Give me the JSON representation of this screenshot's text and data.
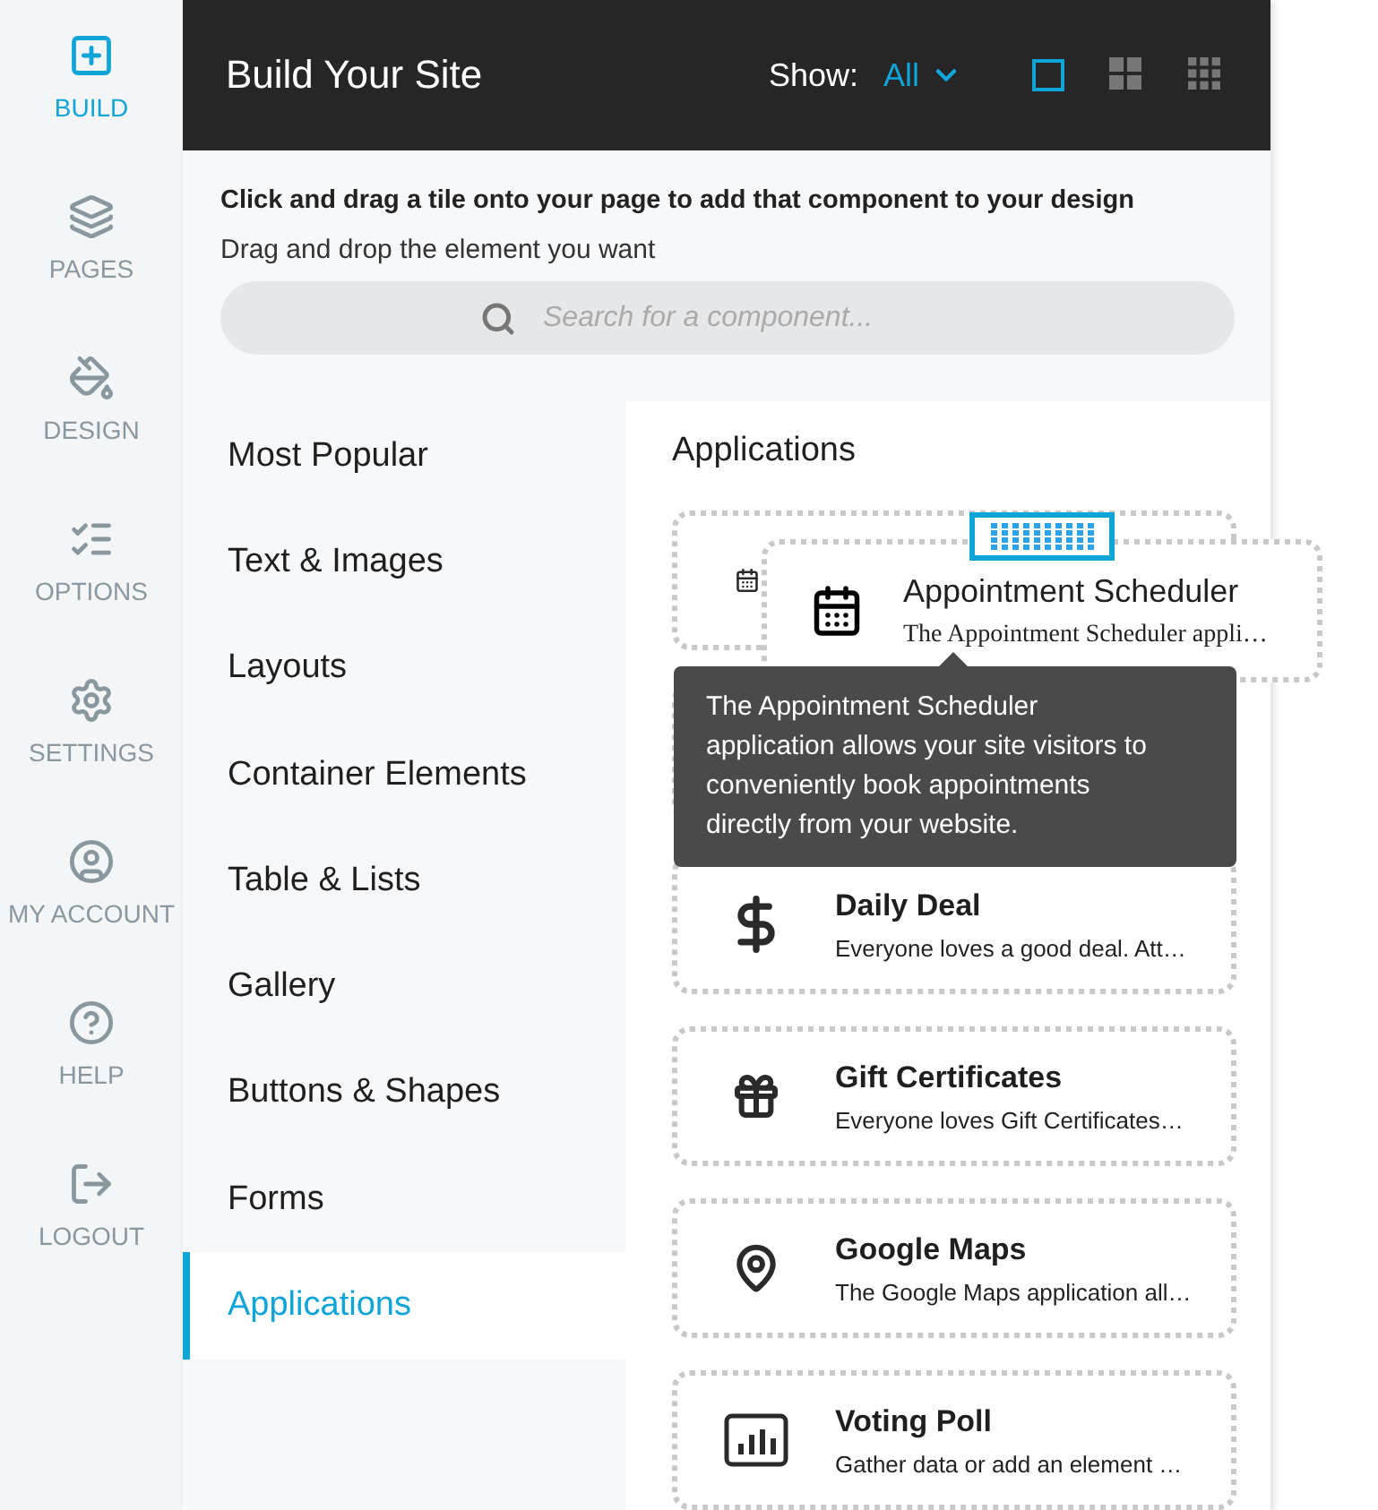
{
  "nav": [
    {
      "label": "BUILD",
      "selected": true
    },
    {
      "label": "PAGES",
      "selected": false
    },
    {
      "label": "DESIGN",
      "selected": false
    },
    {
      "label": "OPTIONS",
      "selected": false
    },
    {
      "label": "SETTINGS",
      "selected": false
    },
    {
      "label": "MY ACCOUNT",
      "selected": false
    },
    {
      "label": "HELP",
      "selected": false
    },
    {
      "label": "LOGOUT",
      "selected": false
    }
  ],
  "header": {
    "title": "Build Your Site",
    "show_label": "Show:",
    "show_value": "All",
    "view_modes": [
      {
        "kind": "single",
        "selected": true
      },
      {
        "kind": "grid4",
        "selected": false
      },
      {
        "kind": "grid9",
        "selected": false
      }
    ]
  },
  "intro": {
    "instruction": "Click and drag a tile onto your page to add that component to your design",
    "hint": "Drag and drop the element you want"
  },
  "search": {
    "placeholder": "Search for a component..."
  },
  "categories": [
    {
      "label": "Most Popular",
      "selected": false
    },
    {
      "label": "Text & Images",
      "selected": false
    },
    {
      "label": "Layouts",
      "selected": false
    },
    {
      "label": "Container Elements",
      "selected": false
    },
    {
      "label": "Table & Lists",
      "selected": false
    },
    {
      "label": "Gallery",
      "selected": false
    },
    {
      "label": "Buttons & Shapes",
      "selected": false
    },
    {
      "label": "Forms",
      "selected": false
    },
    {
      "label": "Applications",
      "selected": true
    }
  ],
  "applications": {
    "heading": "Applications",
    "tiles": [
      {
        "kind": "placeholder"
      },
      {
        "kind": "covered"
      },
      {
        "kind": "tile",
        "title": "Daily Deal",
        "description": "Everyone loves a good deal. Att…"
      },
      {
        "kind": "tile",
        "title": "Gift Certificates",
        "description": "Everyone loves Gift Certificates…"
      },
      {
        "kind": "tile",
        "title": "Google Maps",
        "description": "The Google Maps application all…"
      },
      {
        "kind": "tile",
        "title": "Voting Poll",
        "description": "Gather data or add an element …"
      }
    ]
  },
  "drag_tile": {
    "title": "Appointment Scheduler",
    "description": "The Appointment Scheduler appli…"
  },
  "tooltip": {
    "text": "The Appointment Scheduler application allows your site visitors to conveniently book appointments directly from your website."
  }
}
